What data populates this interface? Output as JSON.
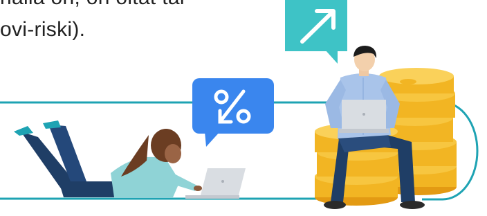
{
  "text": {
    "line1": "nalla on, on oltat tai",
    "line2": "ovi-riski)."
  },
  "icons": {
    "percent_bubble": "percent-icon",
    "growth_bubble": "arrow-up-right-icon"
  },
  "colors": {
    "accent_teal": "#1ea3b3",
    "bubble_blue": "#3a86ee",
    "bubble_teal": "#3ec3c6",
    "coin_gold": "#f2b523",
    "laptop_gray": "#d9dde2"
  }
}
